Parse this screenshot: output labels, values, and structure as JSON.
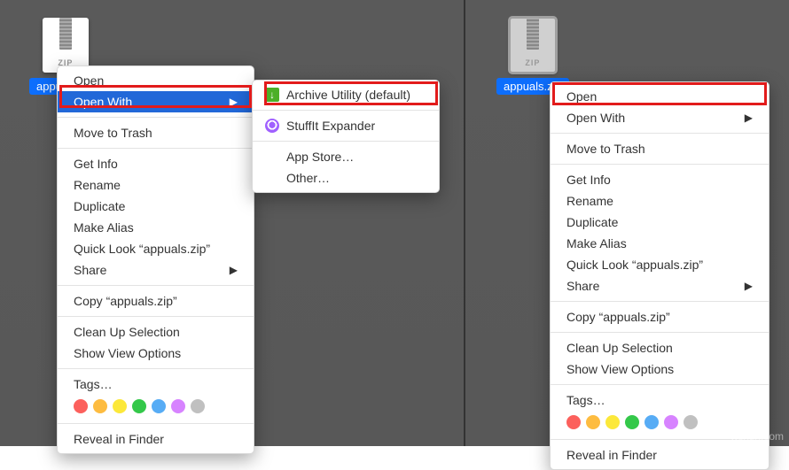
{
  "left": {
    "filename": "appuals.zip",
    "menu": {
      "open": "Open",
      "open_with": "Open With",
      "trash": "Move to Trash",
      "get_info": "Get Info",
      "rename": "Rename",
      "duplicate": "Duplicate",
      "make_alias": "Make Alias",
      "quick_look": "Quick Look “appuals.zip”",
      "share": "Share",
      "copy": "Copy “appuals.zip”",
      "cleanup": "Clean Up Selection",
      "view_opts": "Show View Options",
      "tags": "Tags…",
      "reveal": "Reveal in Finder"
    },
    "submenu": {
      "archive": "Archive Utility (default)",
      "stuffit": "StuffIt Expander",
      "app_store": "App Store…",
      "other": "Other…"
    }
  },
  "right": {
    "filename": "appuals.zip",
    "menu": {
      "open": "Open",
      "open_with": "Open With",
      "trash": "Move to Trash",
      "get_info": "Get Info",
      "rename": "Rename",
      "duplicate": "Duplicate",
      "make_alias": "Make Alias",
      "quick_look": "Quick Look “appuals.zip”",
      "share": "Share",
      "copy": "Copy “appuals.zip”",
      "cleanup": "Clean Up Selection",
      "view_opts": "Show View Options",
      "tags": "Tags…",
      "reveal": "Reveal in Finder"
    }
  },
  "watermark": "wsxdn.com"
}
